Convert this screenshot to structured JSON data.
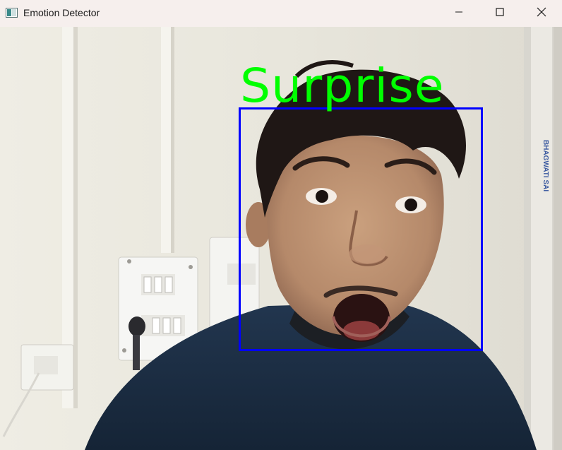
{
  "window": {
    "title": "Emotion Detector",
    "app_icon": "opencv-window-icon",
    "controls": {
      "minimize_icon": "minimize-icon",
      "maximize_icon": "maximize-icon",
      "close_icon": "close-icon"
    }
  },
  "detection": {
    "emotion": "Surprise",
    "label_color": "#00ff00",
    "box_color": "#0000ff"
  },
  "camera": {
    "wall_sign_text": "BHAGWATI SAI"
  }
}
